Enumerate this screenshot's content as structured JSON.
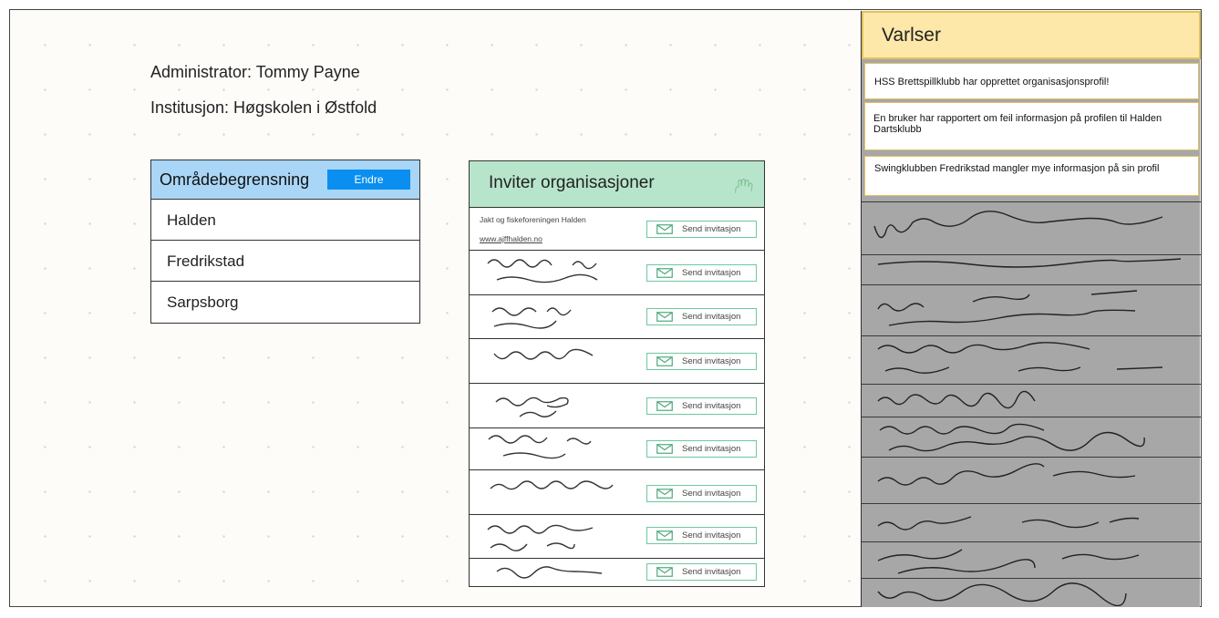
{
  "admin": {
    "label": "Administrator: Tommy Payne"
  },
  "institution": {
    "label": "Institusjon: Høgskolen i Østfold"
  },
  "area_restriction": {
    "title": "Områdebegrensning",
    "edit_label": "Endre",
    "areas": [
      "Halden",
      "Fredrikstad",
      "Sarpsborg"
    ]
  },
  "invite": {
    "title": "Inviter organisasjoner",
    "button_label": "Send invitasjon",
    "first_org": {
      "name": "Jakt og fiskeforeningen Halden",
      "link": "www.ajffhalden.no"
    }
  },
  "notifications": {
    "title": "Varlser",
    "items": [
      "HSS Brettspillklubb har opprettet organisasjonsprofil!",
      "En bruker har rapportert om feil informasjon på profilen til Halden Dartsklubb",
      "Swingklubben Fredrikstad mangler mye informasjon på sin profil"
    ]
  },
  "colors": {
    "area_header": "#a9d6f7",
    "edit_button": "#0a8ff0",
    "invite_header": "#b7e5cb",
    "invite_button_border": "#6cc99c",
    "notif_header": "#fde8a9",
    "notif_border": "#e3c15f",
    "notif_panel": "#a7a7a7"
  }
}
